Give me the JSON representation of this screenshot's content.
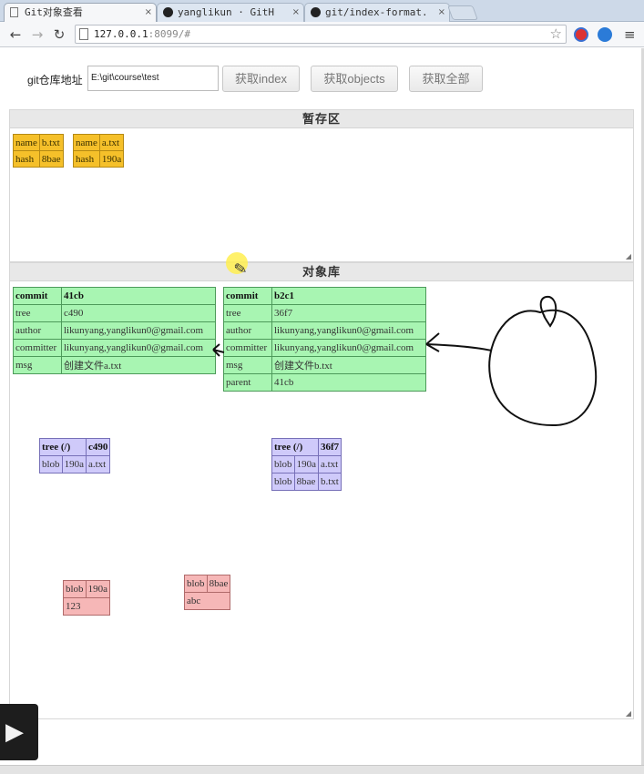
{
  "browser": {
    "tabs": [
      {
        "icon": "page-icon",
        "title": "Git对象查看",
        "active": true
      },
      {
        "icon": "github-icon",
        "title": "yanglikun · GitH"
      },
      {
        "icon": "github-icon",
        "title": "git/index-format."
      }
    ],
    "close_glyph": "×",
    "back_glyph": "←",
    "forward_glyph": "→",
    "reload_glyph": "↻",
    "url_host": "127.0.0.1",
    "url_rest": ":8099/#",
    "star_glyph": "☆",
    "menu_glyph": "≡"
  },
  "toolbar": {
    "repo_label": "git仓库地址",
    "repo_path": "E:\\git\\course\\test",
    "btn_index": "获取index",
    "btn_objects": "获取objects",
    "btn_all": "获取全部"
  },
  "staging": {
    "title": "暂存区",
    "entries": [
      {
        "name_label": "name",
        "name": "b.txt",
        "hash_label": "hash",
        "hash": "8bae"
      },
      {
        "name_label": "name",
        "name": "a.txt",
        "hash_label": "hash",
        "hash": "190a"
      }
    ]
  },
  "objects": {
    "title": "对象库",
    "commits": [
      {
        "type": "commit",
        "id": "41cb",
        "rows": [
          {
            "k": "tree",
            "v": "c490"
          },
          {
            "k": "author",
            "v": "likunyang,yanglikun0@gmail.com"
          },
          {
            "k": "committer",
            "v": "likunyang,yanglikun0@gmail.com"
          },
          {
            "k": "msg",
            "v": "创建文件a.txt"
          }
        ]
      },
      {
        "type": "commit",
        "id": "b2c1",
        "rows": [
          {
            "k": "tree",
            "v": "36f7"
          },
          {
            "k": "author",
            "v": "likunyang,yanglikun0@gmail.com"
          },
          {
            "k": "committer",
            "v": "likunyang,yanglikun0@gmail.com"
          },
          {
            "k": "msg",
            "v": "创建文件b.txt"
          },
          {
            "k": "parent",
            "v": "41cb"
          }
        ]
      }
    ],
    "trees": [
      {
        "type": "tree (/)",
        "id": "c490",
        "rows": [
          {
            "t": "blob",
            "h": "190a",
            "n": "a.txt"
          }
        ]
      },
      {
        "type": "tree (/)",
        "id": "36f7",
        "rows": [
          {
            "t": "blob",
            "h": "190a",
            "n": "a.txt"
          },
          {
            "t": "blob",
            "h": "8bae",
            "n": "b.txt"
          }
        ]
      }
    ],
    "blobs": [
      {
        "type": "blob",
        "id": "190a",
        "content": "123"
      },
      {
        "type": "blob",
        "id": "8bae",
        "content": "abc"
      }
    ]
  },
  "colors": {
    "index": "#f5c02a",
    "commit": "#a8f5b2",
    "tree": "#cfcafa",
    "blob": "#f6b7b7"
  },
  "overlay": {
    "play_glyph": "▶",
    "pencil_glyph": "✎",
    "resize_glyph": "◢"
  }
}
